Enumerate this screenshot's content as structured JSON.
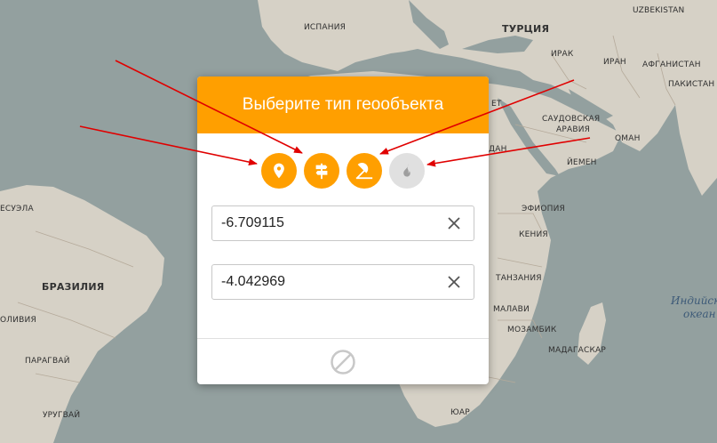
{
  "map": {
    "labels": {
      "uzbekistan": "UZBEKISTAN",
      "spain": "ИСПАНИЯ",
      "turkey": "ТУРЦИЯ",
      "iraq": "ИРАК",
      "iran": "ИРАН",
      "afghanistan": "АФГАНИСТАН",
      "pakistan": "ПАКИСТАН",
      "egypt_partial": "ЕТ",
      "saudi1": "САУДОВСКАЯ",
      "saudi2": "АРАВИЯ",
      "oman": "ОМАН",
      "sudan_partial": "ДАН",
      "yemen": "ЙЕМЕН",
      "ethiopia": "ЭФИОПИЯ",
      "kenya": "КЕНИЯ",
      "tanzania": "ТАНЗАНИЯ",
      "malawi": "МАЛАВИ",
      "mozambique": "МОЗАМБИК",
      "madagascar": "МАДАГАСКАР",
      "zar": "ЮАР",
      "venezuela_partial": "ЕСУЭЛА",
      "brazil": "БРАЗИЛИЯ",
      "bolivia_partial": "ОЛИВИЯ",
      "paraguay": "ПАРАГВАЙ",
      "uruguay": "УРУГВАЙ"
    },
    "ocean": {
      "line1": "Индийск",
      "line2": "океан"
    }
  },
  "dialog": {
    "title": "Выберите тип геообъекта",
    "types": [
      {
        "icon": "location-pin-icon",
        "active": true
      },
      {
        "icon": "signpost-icon",
        "active": true
      },
      {
        "icon": "beach-icon",
        "active": true
      },
      {
        "icon": "fire-icon",
        "active": false
      }
    ],
    "latitude": "-6.709115",
    "longitude": "-4.042969",
    "cancel_icon": "cancel-icon"
  },
  "colors": {
    "accent": "#ff9f00",
    "inactive": "#e0e0e0",
    "arrow": "#e00000",
    "water": "#93a09f",
    "land": "#d6d1c6"
  }
}
